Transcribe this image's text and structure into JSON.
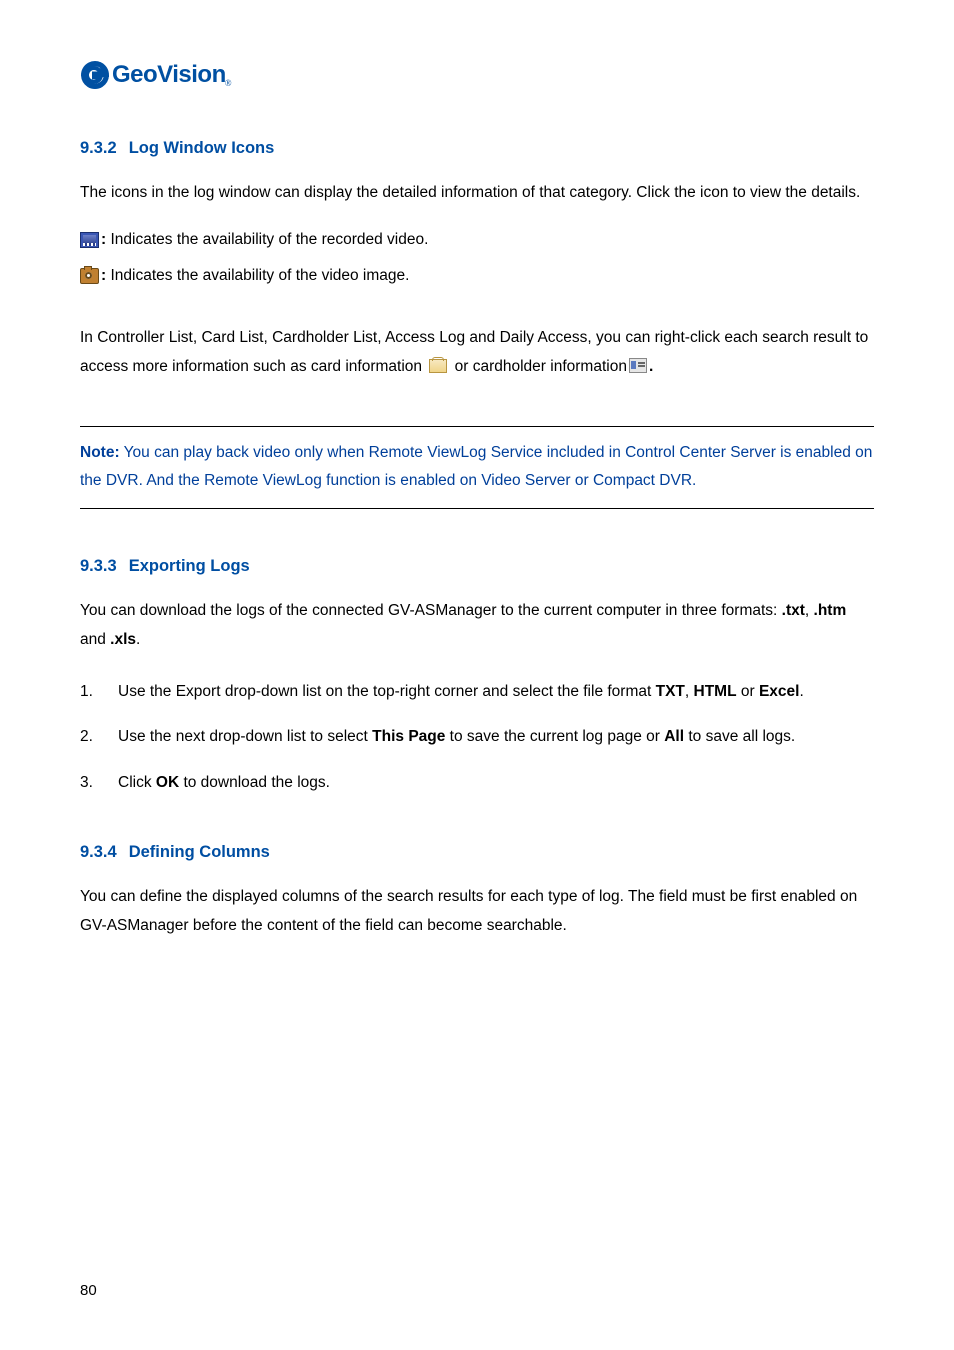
{
  "logo": {
    "brand": "GeoVision",
    "sub": "®"
  },
  "s1": {
    "num": "9.3.2",
    "title": "Log Window Icons",
    "intro": "The icons in the log window can display the detailed information of that category. Click the icon to view the details.",
    "icon1_b": ":",
    "icon1_t": " Indicates the availability of the recorded video.",
    "icon2_b": ":",
    "icon2_t": " Indicates the availability of the video image.",
    "ctx1": "In Controller List, Card List, Cardholder List, Access Log and Daily Access, you can right-click each search result to access more information such as card information ",
    "ctx2": " or cardholder information",
    "ctx3": "."
  },
  "note": {
    "label": "Note:",
    "text": " You can play back video only when Remote ViewLog Service included in Control Center Server is enabled on the DVR. And the Remote ViewLog function is enabled on Video Server or Compact DVR."
  },
  "s2": {
    "num": "9.3.3",
    "title": "Exporting Logs",
    "intro_a": "You can download the logs of the connected GV-ASManager to the current computer in three formats: ",
    "fmt1": ".txt",
    "sep1": ", ",
    "fmt2": ".htm",
    "sep2": " and ",
    "fmt3": ".xls",
    "intro_end": ".",
    "step1_a": "Use the Export drop-down list on the top-right corner and select the file format ",
    "step1_b1": "TXT",
    "step1_mid1": ", ",
    "step1_b2": "HTML",
    "step1_mid2": " or ",
    "step1_b3": "Excel",
    "step1_end": ".",
    "step2_a": "Use the next drop-down list to select ",
    "step2_b1": "This Page",
    "step2_mid": " to save the current log page or ",
    "step2_b2": "All",
    "step2_end": " to save all logs.",
    "step3_a": "Click ",
    "step3_b": "OK",
    "step3_end": " to download the logs.",
    "n1": "1.",
    "n2": "2.",
    "n3": "3."
  },
  "s3": {
    "num": "9.3.4",
    "title": "Defining Columns",
    "intro": "You can define the displayed columns of the search results for each type of log. The field must be first enabled on GV-ASManager before the content of the field can become searchable."
  },
  "pagenum": "80"
}
